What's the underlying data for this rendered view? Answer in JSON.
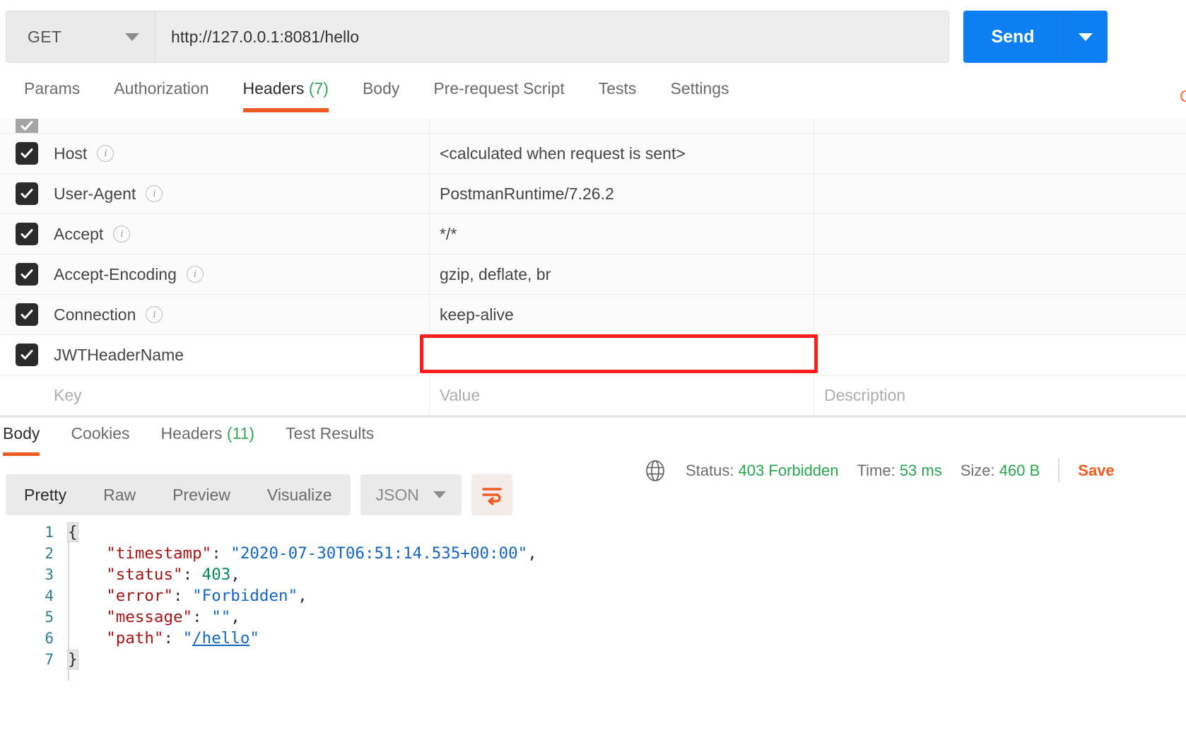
{
  "request": {
    "method": "GET",
    "method_icon": "chevron-down-icon",
    "url": "http://127.0.0.1:8081/hello",
    "send_label": "Send",
    "send_caret_icon": "chevron-down-icon",
    "tabs": [
      {
        "label": "Params",
        "active": false,
        "count": ""
      },
      {
        "label": "Authorization",
        "active": false,
        "count": ""
      },
      {
        "label": "Headers",
        "active": true,
        "count": "(7)"
      },
      {
        "label": "Body",
        "active": false,
        "count": ""
      },
      {
        "label": "Pre-request Script",
        "active": false,
        "count": ""
      },
      {
        "label": "Tests",
        "active": false,
        "count": ""
      },
      {
        "label": "Settings",
        "active": false,
        "count": ""
      }
    ],
    "cookies_link": "Cookies"
  },
  "headers_table": {
    "columns": [
      "Key",
      "Value",
      "Description"
    ],
    "rows": [
      {
        "checked": true,
        "key": "Host",
        "info": "i",
        "value": "<calculated when request is sent>",
        "description": ""
      },
      {
        "checked": true,
        "key": "User-Agent",
        "info": "i",
        "value": "PostmanRuntime/7.26.2",
        "description": ""
      },
      {
        "checked": true,
        "key": "Accept",
        "info": "i",
        "value": "*/*",
        "description": ""
      },
      {
        "checked": true,
        "key": "Accept-Encoding",
        "info": "i",
        "value": "gzip, deflate, br",
        "description": ""
      },
      {
        "checked": true,
        "key": "Connection",
        "info": "i",
        "value": "keep-alive",
        "description": ""
      },
      {
        "checked": true,
        "key": "JWTHeaderName",
        "info": "",
        "value": "",
        "description": ""
      }
    ],
    "placeholder_row": {
      "key": "Key",
      "value": "Value",
      "description": "Description"
    },
    "highlight_color": "#fc1d1d"
  },
  "response": {
    "tabs": [
      {
        "label": "Body",
        "active": true,
        "count": ""
      },
      {
        "label": "Cookies",
        "active": false,
        "count": ""
      },
      {
        "label": "Headers",
        "active": false,
        "count": "(11)"
      },
      {
        "label": "Test Results",
        "active": false,
        "count": ""
      }
    ],
    "globe_icon": "globe-icon",
    "status_label": "Status:",
    "status_value": "403 Forbidden",
    "time_label": "Time:",
    "time_value": "53 ms",
    "size_label": "Size:",
    "size_value": "460 B",
    "save_label": "Save",
    "status_color": "#2aa44f",
    "save_color": "#f15a24",
    "format_tabs": [
      {
        "label": "Pretty",
        "active": true
      },
      {
        "label": "Raw",
        "active": false
      },
      {
        "label": "Preview",
        "active": false
      },
      {
        "label": "Visualize",
        "active": false
      }
    ],
    "language": "JSON",
    "language_caret_icon": "chevron-down-icon",
    "wrap_icon": "word-wrap-icon",
    "body_lines": [
      {
        "num": "1",
        "segments": [
          {
            "t": "{",
            "c": "p hl"
          }
        ]
      },
      {
        "num": "2",
        "segments": [
          {
            "t": "    ",
            "c": "p"
          },
          {
            "t": "\"timestamp\"",
            "c": "k"
          },
          {
            "t": ": ",
            "c": "p"
          },
          {
            "t": "\"2020-07-30T06:51:14.535+00:00\"",
            "c": "s"
          },
          {
            "t": ",",
            "c": "p"
          }
        ]
      },
      {
        "num": "3",
        "segments": [
          {
            "t": "    ",
            "c": "p"
          },
          {
            "t": "\"status\"",
            "c": "k"
          },
          {
            "t": ": ",
            "c": "p"
          },
          {
            "t": "403",
            "c": "n"
          },
          {
            "t": ",",
            "c": "p"
          }
        ]
      },
      {
        "num": "4",
        "segments": [
          {
            "t": "    ",
            "c": "p"
          },
          {
            "t": "\"error\"",
            "c": "k"
          },
          {
            "t": ": ",
            "c": "p"
          },
          {
            "t": "\"Forbidden\"",
            "c": "s"
          },
          {
            "t": ",",
            "c": "p"
          }
        ]
      },
      {
        "num": "5",
        "segments": [
          {
            "t": "    ",
            "c": "p"
          },
          {
            "t": "\"message\"",
            "c": "k"
          },
          {
            "t": ": ",
            "c": "p"
          },
          {
            "t": "\"\"",
            "c": "s"
          },
          {
            "t": ",",
            "c": "p"
          }
        ]
      },
      {
        "num": "6",
        "segments": [
          {
            "t": "    ",
            "c": "p"
          },
          {
            "t": "\"path\"",
            "c": "k"
          },
          {
            "t": ": ",
            "c": "p"
          },
          {
            "t": "\"",
            "c": "s"
          },
          {
            "t": "/hello",
            "c": "lnk"
          },
          {
            "t": "\"",
            "c": "s"
          }
        ]
      },
      {
        "num": "7",
        "segments": [
          {
            "t": "}",
            "c": "p hl"
          }
        ]
      }
    ]
  }
}
